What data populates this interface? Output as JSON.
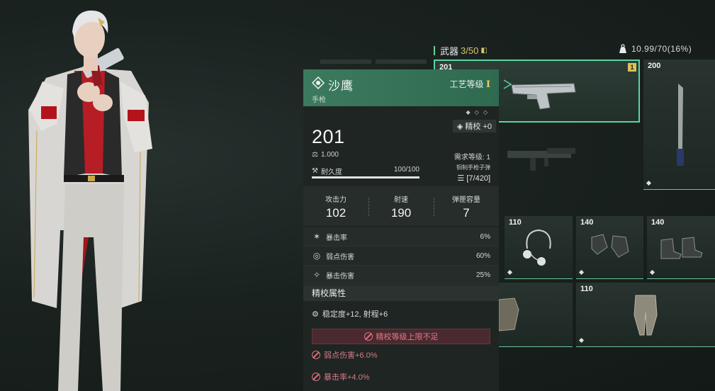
{
  "inventory": {
    "category": "武器",
    "count": "3/50",
    "weight": "10.99/70(16%)",
    "slots": [
      {
        "level": "201",
        "tier": "1"
      },
      {
        "level": "200"
      },
      {
        "level": ""
      },
      {
        "level": "110"
      },
      {
        "level": "140"
      },
      {
        "level": "140"
      },
      {
        "level": ""
      },
      {
        "level": "110"
      }
    ]
  },
  "detail": {
    "name": "沙鹰",
    "type": "手枪",
    "craft_label": "工艺等级",
    "craft_level": "I",
    "refine_tag": "精校 +0",
    "power": "201",
    "weight": "1.000",
    "required_level": "需求等级: 1",
    "durability_label": "耐久度",
    "durability_value": "100/100",
    "durability_fraction": 1.0,
    "ammo_type": "铜制手枪子弹",
    "ammo_count": "[7/420]",
    "main_stats": [
      {
        "label": "攻击力",
        "value": "102"
      },
      {
        "label": "射速",
        "value": "190"
      },
      {
        "label": "弹匣容量",
        "value": "7"
      }
    ],
    "sub_stats": [
      {
        "label": "暴击率",
        "value": "6%",
        "icon": "crit-rate-icon"
      },
      {
        "label": "弱点伤害",
        "value": "60%",
        "icon": "weakspot-icon"
      },
      {
        "label": "暴击伤害",
        "value": "25%",
        "icon": "crit-damage-icon"
      }
    ],
    "refine_title": "精校属性",
    "refine_bonus": "稳定度+12, 射程+6",
    "refine_warning": "精校等级上限不足",
    "locked_bonuses": [
      "弱点伤害+6.0%",
      "暴击率+4.0%"
    ]
  }
}
